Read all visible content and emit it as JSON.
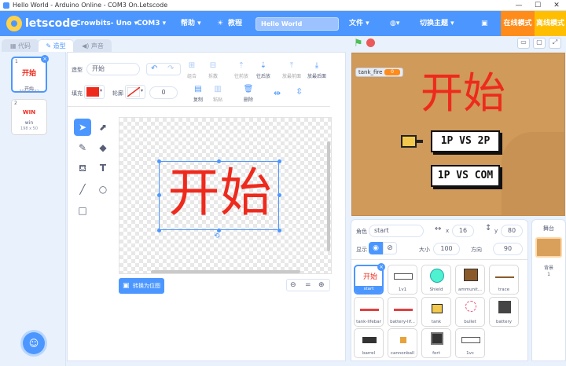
{
  "window": {
    "title": "Hello World - Arduino Online - COM3 On.Letscode",
    "min": "—",
    "max": "☐",
    "close": "✕"
  },
  "menubar": {
    "brand": "letscode",
    "device": "Crowbits- Uno ▾",
    "port": "COM3 ▾",
    "help": "帮助 ▾",
    "tutorial": "教程",
    "project_title": "Hello World",
    "file": "文件 ▾",
    "theme": "切换主题 ▾",
    "online": "在线模式",
    "offline": "离线模式"
  },
  "tabs": [
    {
      "label": "代码"
    },
    {
      "label": "造型"
    },
    {
      "label": "声音"
    }
  ],
  "costumes": [
    {
      "num": "1",
      "thumb": "开始",
      "name": "开始",
      "size": "304 x 132"
    },
    {
      "num": "2",
      "thumb": "WIN",
      "name": "win",
      "size": "198 x 50"
    }
  ],
  "paint": {
    "costume_label": "造型",
    "costume_name": "开始",
    "fill_label": "填充",
    "outline_label": "轮廓",
    "outline_width": "0",
    "group": "组合",
    "ungroup": "拆散",
    "forward": "往前放",
    "backward": "往后放",
    "front": "放最前面",
    "back": "放最后面",
    "copy": "复制",
    "paste": "粘贴",
    "delete": "删除",
    "canvas_text": "开始",
    "convert": "转换为位图",
    "zoom_eq": "="
  },
  "stage": {
    "title": "开始",
    "btn1": "1P VS 2P",
    "btn2": "1P VS COM",
    "var_name": "tank_fire",
    "var_value": "0"
  },
  "sprite_info": {
    "sprite_label": "角色",
    "sprite_name": "start",
    "x_label": "x",
    "x_value": "16",
    "y_label": "y",
    "y_value": "80",
    "show_label": "显示",
    "size_label": "大小",
    "size_value": "100",
    "dir_label": "方向",
    "dir_value": "90"
  },
  "sprites": [
    {
      "name": "start"
    },
    {
      "name": "1v1"
    },
    {
      "name": "Shield"
    },
    {
      "name": "ammunit..."
    },
    {
      "name": "trace"
    },
    {
      "name": "tank-lifebar"
    },
    {
      "name": "battery-lif..."
    },
    {
      "name": "tank"
    },
    {
      "name": "bullet"
    },
    {
      "name": "battery"
    },
    {
      "name": "barrel"
    },
    {
      "name": "cannonball"
    },
    {
      "name": "fort"
    },
    {
      "name": "1vc"
    }
  ],
  "stage_panel": {
    "title": "舞台",
    "backdrop_label": "背景",
    "backdrop_count": "1"
  },
  "colors": {
    "accent": "#4c97ff",
    "fill": "#ee2a1d",
    "orange": "#ff8c1a",
    "yellow": "#ffbf00"
  }
}
